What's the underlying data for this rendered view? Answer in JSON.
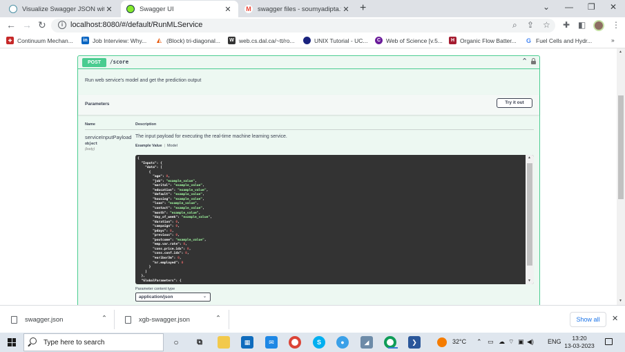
{
  "browser": {
    "tabs": [
      {
        "title": "Visualize Swagger JSON with Do",
        "close": "✕"
      },
      {
        "title": "Swagger UI",
        "close": "✕"
      },
      {
        "title": "swagger files - soumyadipta.tue",
        "close": "✕"
      }
    ],
    "new_tab": "+",
    "window_controls": {
      "minimize": "⌄",
      "min": "—",
      "restore": "❐",
      "close": "✕"
    },
    "url": "localhost:8080/#/default/RunMLService",
    "bookmarks": [
      "Continuum Mechan...",
      "Job Interview: Why...",
      "(Block) tri-diagonal...",
      "web.cs.dal.ca/~tt/ro...",
      "UNIX Tutorial - UC...",
      "Web of Science [v.5...",
      "Organic Flow Batter...",
      "Fuel Cells and Hydr..."
    ],
    "bookmarks_more": "»"
  },
  "swagger": {
    "method": "POST",
    "path": "/score",
    "summary": "Run web service's model and get the prediction output",
    "parameters_title": "Parameters",
    "try_it_out": "Try it out",
    "col_name": "Name",
    "col_description": "Description",
    "param": {
      "name": "serviceInputPayload",
      "type": "object",
      "in": "(body)",
      "description": "The input payload for executing the real-time machine learning service."
    },
    "example_tab": "Example Value",
    "model_tab": "Model",
    "example_sep": "|",
    "code_lines": [
      "{",
      "  \"Inputs\": {",
      "    \"data\": [",
      "      {",
      "        \"age\": 0,",
      "        \"job\": \"example_value\",",
      "        \"marital\": \"example_value\",",
      "        \"education\": \"example_value\",",
      "        \"default\": \"example_value\",",
      "        \"housing\": \"example_value\",",
      "        \"loan\": \"example_value\",",
      "        \"contact\": \"example_value\",",
      "        \"month\": \"example_value\",",
      "        \"day_of_week\": \"example_value\",",
      "        \"duration\": 0,",
      "        \"campaign\": 0,",
      "        \"pdays\": 0,",
      "        \"previous\": 0,",
      "        \"poutcome\": \"example_value\",",
      "        \"emp.var.rate\": 0,",
      "        \"cons.price.idx\": 0,",
      "        \"cons.conf.idx\": 0,",
      "        \"euribor3m\": 0,",
      "        \"nr.employed\": 0",
      "      }",
      "    ]",
      "  },",
      "  \"GlobalParameters\": {"
    ],
    "content_type_label": "Parameter content type",
    "content_type_value": "application/json"
  },
  "downloads": {
    "items": [
      "swagger.json",
      "xgb-swagger.json"
    ],
    "show_all": "Show all",
    "close": "✕"
  },
  "taskbar": {
    "search_placeholder": "Type here to search",
    "weather": "32°C",
    "language": "ENG",
    "time": "13:20",
    "date": "13-03-2023"
  },
  "colors": {
    "post_green": "#49cc90",
    "code_bg": "#333333",
    "string_green": "#a2fca2",
    "number_red": "#d36363",
    "link_blue": "#1a73e8"
  }
}
